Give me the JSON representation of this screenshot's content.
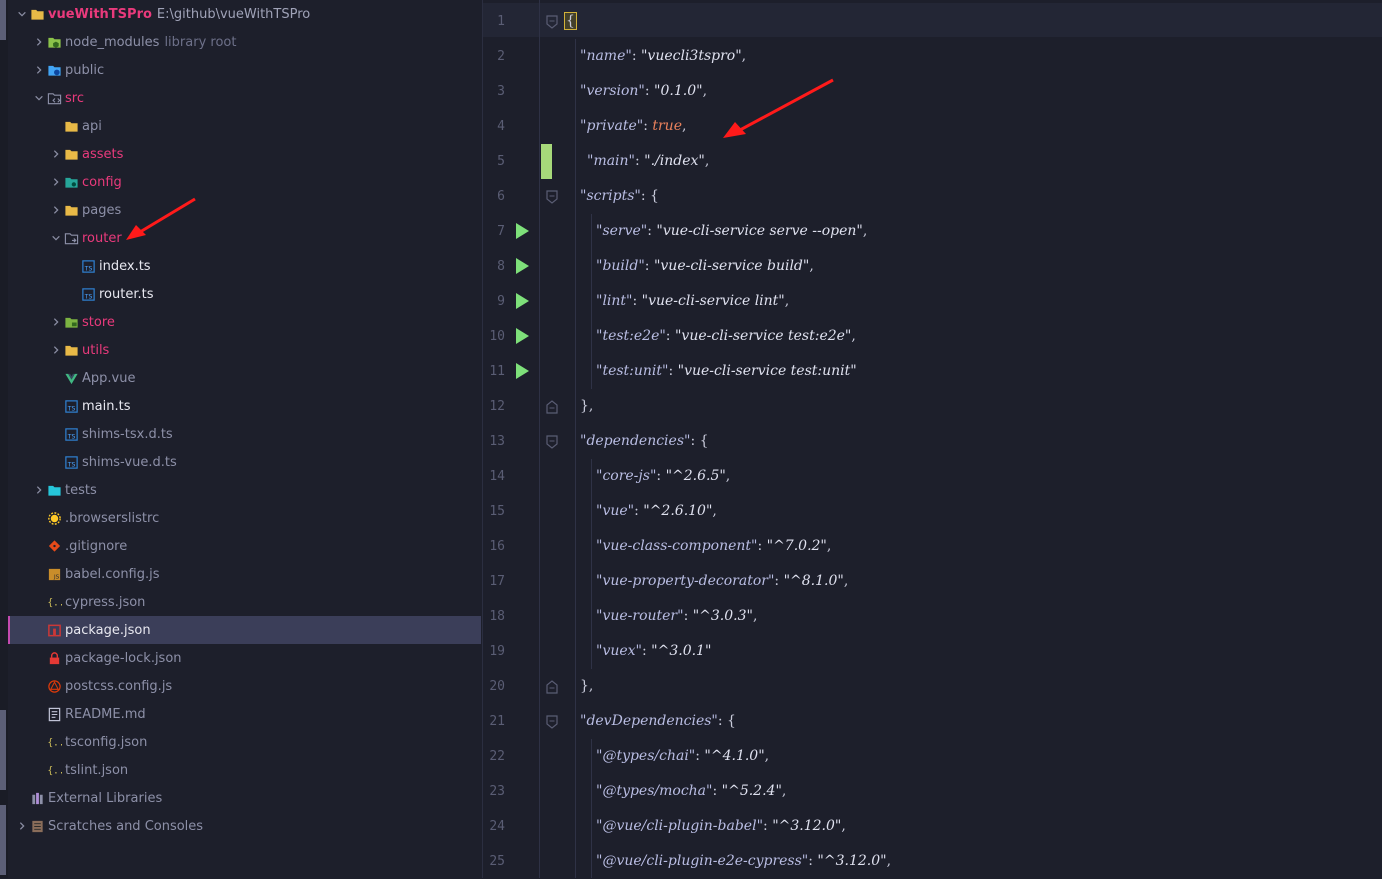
{
  "project": {
    "name": "vueWithTSPro",
    "path": "E:\\github\\vueWithTSPro"
  },
  "tree": [
    {
      "level": 0,
      "chevron": "down",
      "icon": "folder-icon",
      "name": "vueWithTSPro",
      "hint": "E:\\github\\vueWithTSPro",
      "style": "bold-red"
    },
    {
      "level": 1,
      "chevron": "right",
      "icon": "node-modules-folder-icon",
      "name": "node_modules",
      "hint": "library root",
      "style": "normal"
    },
    {
      "level": 1,
      "chevron": "right",
      "icon": "globe-folder-icon",
      "name": "public",
      "style": "normal"
    },
    {
      "level": 1,
      "chevron": "down",
      "icon": "src-folder-icon",
      "name": "src",
      "style": "red"
    },
    {
      "level": 2,
      "chevron": "none",
      "icon": "folder-icon",
      "name": "api",
      "style": "normal"
    },
    {
      "level": 2,
      "chevron": "right",
      "icon": "folder-icon",
      "name": "assets",
      "style": "red"
    },
    {
      "level": 2,
      "chevron": "right",
      "icon": "config-folder-icon",
      "name": "config",
      "style": "red"
    },
    {
      "level": 2,
      "chevron": "right",
      "icon": "folder-icon",
      "name": "pages",
      "style": "normal"
    },
    {
      "level": 2,
      "chevron": "down",
      "icon": "router-folder-icon",
      "name": "router",
      "style": "red"
    },
    {
      "level": 3,
      "chevron": "none",
      "icon": "typescript-file-icon",
      "name": "index.ts",
      "style": "strong"
    },
    {
      "level": 3,
      "chevron": "none",
      "icon": "typescript-file-icon",
      "name": "router.ts",
      "style": "strong"
    },
    {
      "level": 2,
      "chevron": "right",
      "icon": "store-folder-icon",
      "name": "store",
      "style": "red"
    },
    {
      "level": 2,
      "chevron": "right",
      "icon": "folder-icon",
      "name": "utils",
      "style": "red"
    },
    {
      "level": 2,
      "chevron": "none",
      "icon": "vue-file-icon",
      "name": "App.vue",
      "style": "normal"
    },
    {
      "level": 2,
      "chevron": "none",
      "icon": "typescript-file-icon",
      "name": "main.ts",
      "style": "strong"
    },
    {
      "level": 2,
      "chevron": "none",
      "icon": "typescript-file-icon",
      "name": "shims-tsx.d.ts",
      "style": "normal"
    },
    {
      "level": 2,
      "chevron": "none",
      "icon": "typescript-file-icon",
      "name": "shims-vue.d.ts",
      "style": "normal"
    },
    {
      "level": 1,
      "chevron": "right",
      "icon": "tests-folder-icon",
      "name": "tests",
      "style": "normal"
    },
    {
      "level": 1,
      "chevron": "none",
      "icon": "browserslist-file-icon",
      "name": ".browserslistrc",
      "style": "normal"
    },
    {
      "level": 1,
      "chevron": "none",
      "icon": "git-file-icon",
      "name": ".gitignore",
      "style": "normal"
    },
    {
      "level": 1,
      "chevron": "none",
      "icon": "javascript-file-icon",
      "name": "babel.config.js",
      "style": "normal"
    },
    {
      "level": 1,
      "chevron": "none",
      "icon": "json-file-icon",
      "name": "cypress.json",
      "style": "normal"
    },
    {
      "level": 1,
      "chevron": "none",
      "icon": "npm-file-icon",
      "name": "package.json",
      "style": "strong",
      "selected": true
    },
    {
      "level": 1,
      "chevron": "none",
      "icon": "lock-file-icon",
      "name": "package-lock.json",
      "style": "normal"
    },
    {
      "level": 1,
      "chevron": "none",
      "icon": "postcss-file-icon",
      "name": "postcss.config.js",
      "style": "normal"
    },
    {
      "level": 1,
      "chevron": "none",
      "icon": "markdown-file-icon",
      "name": "README.md",
      "style": "normal"
    },
    {
      "level": 1,
      "chevron": "none",
      "icon": "json-file-icon",
      "name": "tsconfig.json",
      "style": "normal"
    },
    {
      "level": 1,
      "chevron": "none",
      "icon": "json-file-icon",
      "name": "tslint.json",
      "style": "normal"
    },
    {
      "level": 0,
      "chevron": "none",
      "icon": "libraries-icon",
      "name": "External Libraries",
      "style": "normal"
    },
    {
      "level": 0,
      "chevron": "right",
      "icon": "scratches-icon",
      "name": "Scratches and Consoles",
      "style": "normal"
    }
  ],
  "editor": {
    "file": "package.json",
    "lines": [
      {
        "n": "1",
        "indent": 0,
        "tokens": [
          {
            "t": "{",
            "c": "bracket"
          }
        ],
        "fold": "open"
      },
      {
        "n": "2",
        "indent": 1,
        "tokens": [
          {
            "t": "\"name\"",
            "c": "k"
          },
          {
            "t": ": ",
            "c": "p"
          },
          {
            "t": "\"vuecli3tspro\"",
            "c": "s"
          },
          {
            "t": ",",
            "c": "p"
          }
        ]
      },
      {
        "n": "3",
        "indent": 1,
        "tokens": [
          {
            "t": "\"version\"",
            "c": "k"
          },
          {
            "t": ": ",
            "c": "p"
          },
          {
            "t": "\"0.1.0\"",
            "c": "s"
          },
          {
            "t": ",",
            "c": "p"
          }
        ]
      },
      {
        "n": "4",
        "indent": 1,
        "tokens": [
          {
            "t": "\"private\"",
            "c": "k"
          },
          {
            "t": ": ",
            "c": "p"
          },
          {
            "t": "true",
            "c": "bool"
          },
          {
            "t": ",",
            "c": "p"
          }
        ]
      },
      {
        "n": "5",
        "indent": 1,
        "pad": 1,
        "change": true,
        "tokens": [
          {
            "t": "\"main\"",
            "c": "k"
          },
          {
            "t": ": ",
            "c": "p"
          },
          {
            "t": "\"./index\"",
            "c": "s"
          },
          {
            "t": ",",
            "c": "p"
          }
        ]
      },
      {
        "n": "6",
        "indent": 1,
        "fold": "open",
        "tokens": [
          {
            "t": "\"scripts\"",
            "c": "k"
          },
          {
            "t": ": {",
            "c": "p"
          }
        ]
      },
      {
        "n": "7",
        "indent": 2,
        "run": true,
        "tokens": [
          {
            "t": "\"serve\"",
            "c": "k"
          },
          {
            "t": ": ",
            "c": "p"
          },
          {
            "t": "\"vue-cli-service serve --open\"",
            "c": "s"
          },
          {
            "t": ",",
            "c": "p"
          }
        ]
      },
      {
        "n": "8",
        "indent": 2,
        "run": true,
        "tokens": [
          {
            "t": "\"build\"",
            "c": "k"
          },
          {
            "t": ": ",
            "c": "p"
          },
          {
            "t": "\"vue-cli-service build\"",
            "c": "s"
          },
          {
            "t": ",",
            "c": "p"
          }
        ]
      },
      {
        "n": "9",
        "indent": 2,
        "run": true,
        "tokens": [
          {
            "t": "\"lint\"",
            "c": "k"
          },
          {
            "t": ": ",
            "c": "p"
          },
          {
            "t": "\"vue-cli-service lint\"",
            "c": "s"
          },
          {
            "t": ",",
            "c": "p"
          }
        ]
      },
      {
        "n": "10",
        "indent": 2,
        "run": true,
        "tokens": [
          {
            "t": "\"test:e2e\"",
            "c": "k"
          },
          {
            "t": ": ",
            "c": "p"
          },
          {
            "t": "\"vue-cli-service test:e2e\"",
            "c": "s"
          },
          {
            "t": ",",
            "c": "p"
          }
        ]
      },
      {
        "n": "11",
        "indent": 2,
        "run": true,
        "tokens": [
          {
            "t": "\"test:unit\"",
            "c": "k"
          },
          {
            "t": ": ",
            "c": "p"
          },
          {
            "t": "\"vue-cli-service test:unit\"",
            "c": "s"
          }
        ]
      },
      {
        "n": "12",
        "indent": 1,
        "fold": "close",
        "tokens": [
          {
            "t": "},",
            "c": "p"
          }
        ]
      },
      {
        "n": "13",
        "indent": 1,
        "fold": "open",
        "tokens": [
          {
            "t": "\"dependencies\"",
            "c": "k"
          },
          {
            "t": ": {",
            "c": "p"
          }
        ]
      },
      {
        "n": "14",
        "indent": 2,
        "tokens": [
          {
            "t": "\"core-js\"",
            "c": "k"
          },
          {
            "t": ": ",
            "c": "p"
          },
          {
            "t": "\"^2.6.5\"",
            "c": "s"
          },
          {
            "t": ",",
            "c": "p"
          }
        ]
      },
      {
        "n": "15",
        "indent": 2,
        "tokens": [
          {
            "t": "\"vue\"",
            "c": "k"
          },
          {
            "t": ": ",
            "c": "p"
          },
          {
            "t": "\"^2.6.10\"",
            "c": "s"
          },
          {
            "t": ",",
            "c": "p"
          }
        ]
      },
      {
        "n": "16",
        "indent": 2,
        "tokens": [
          {
            "t": "\"vue-class-component\"",
            "c": "k"
          },
          {
            "t": ": ",
            "c": "p"
          },
          {
            "t": "\"^7.0.2\"",
            "c": "s"
          },
          {
            "t": ",",
            "c": "p"
          }
        ]
      },
      {
        "n": "17",
        "indent": 2,
        "tokens": [
          {
            "t": "\"vue-property-decorator\"",
            "c": "k"
          },
          {
            "t": ": ",
            "c": "p"
          },
          {
            "t": "\"^8.1.0\"",
            "c": "s"
          },
          {
            "t": ",",
            "c": "p"
          }
        ]
      },
      {
        "n": "18",
        "indent": 2,
        "tokens": [
          {
            "t": "\"vue-router\"",
            "c": "k"
          },
          {
            "t": ": ",
            "c": "p"
          },
          {
            "t": "\"^3.0.3\"",
            "c": "s"
          },
          {
            "t": ",",
            "c": "p"
          }
        ]
      },
      {
        "n": "19",
        "indent": 2,
        "tokens": [
          {
            "t": "\"vuex\"",
            "c": "k"
          },
          {
            "t": ": ",
            "c": "p"
          },
          {
            "t": "\"^3.0.1\"",
            "c": "s"
          }
        ]
      },
      {
        "n": "20",
        "indent": 1,
        "fold": "close",
        "tokens": [
          {
            "t": "},",
            "c": "p"
          }
        ]
      },
      {
        "n": "21",
        "indent": 1,
        "fold": "open",
        "tokens": [
          {
            "t": "\"devDependencies\"",
            "c": "k"
          },
          {
            "t": ": {",
            "c": "p"
          }
        ]
      },
      {
        "n": "22",
        "indent": 2,
        "tokens": [
          {
            "t": "\"@types/chai\"",
            "c": "k"
          },
          {
            "t": ": ",
            "c": "p"
          },
          {
            "t": "\"^4.1.0\"",
            "c": "s"
          },
          {
            "t": ",",
            "c": "p"
          }
        ]
      },
      {
        "n": "23",
        "indent": 2,
        "tokens": [
          {
            "t": "\"@types/mocha\"",
            "c": "k"
          },
          {
            "t": ": ",
            "c": "p"
          },
          {
            "t": "\"^5.2.4\"",
            "c": "s"
          },
          {
            "t": ",",
            "c": "p"
          }
        ]
      },
      {
        "n": "24",
        "indent": 2,
        "tokens": [
          {
            "t": "\"@vue/cli-plugin-babel\"",
            "c": "k"
          },
          {
            "t": ": ",
            "c": "p"
          },
          {
            "t": "\"^3.12.0\"",
            "c": "s"
          },
          {
            "t": ",",
            "c": "p"
          }
        ]
      },
      {
        "n": "25",
        "indent": 2,
        "tokens": [
          {
            "t": "\"@vue/cli-plugin-e2e-cypress\"",
            "c": "k"
          },
          {
            "t": ": ",
            "c": "p"
          },
          {
            "t": "\"^3.12.0\"",
            "c": "s"
          },
          {
            "t": ",",
            "c": "p"
          }
        ]
      }
    ]
  },
  "colors": {
    "background": "#1d1f2b",
    "selection": "#3b3e59",
    "accent_red": "#e93a7c",
    "run_green": "#7ee07a",
    "change_green": "#a7d97a",
    "arrow_red": "#ff1a1a"
  }
}
